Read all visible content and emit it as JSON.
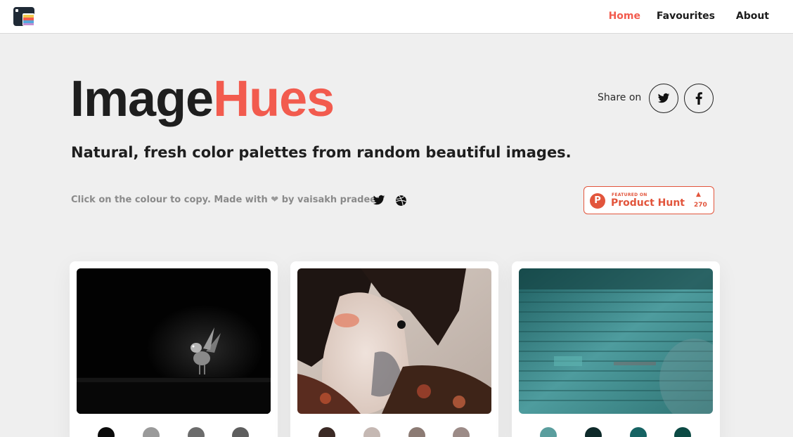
{
  "nav": {
    "items": [
      {
        "label": "Home",
        "active": true
      },
      {
        "label": "Favourites",
        "active": false
      },
      {
        "label": "About",
        "active": false
      }
    ],
    "accent": "#f25b4e"
  },
  "hero": {
    "brand_part1": "Image",
    "brand_part2": "Hues",
    "share_label": "Share on",
    "share_icons": [
      "twitter-icon",
      "facebook-icon"
    ],
    "tagline": "Natural, fresh color palettes from random beautiful images.",
    "credits_prefix": "Click on the colour to copy. Made with",
    "credits_suffix": "by vaisakh pradeep",
    "credits_icons": [
      "heart-icon",
      "twitter-icon",
      "dribbble-icon"
    ]
  },
  "product_hunt": {
    "featured": "FEATURED ON",
    "name": "Product Hunt",
    "letter": "P",
    "upvotes": "270",
    "color": "#e2553c"
  },
  "cards": [
    {
      "subject": "bird on black",
      "swatches": [
        "#0b0b0b",
        "#9a9a9a",
        "#6c6c6c",
        "#5e5e5e"
      ]
    },
    {
      "subject": "woman with tattoo",
      "swatches": [
        "#3b2a25",
        "#c5b8b3",
        "#8c7b74",
        "#9c8b87"
      ]
    },
    {
      "subject": "teal wooden wall",
      "swatches": [
        "#5a9e9e",
        "#0e2a2a",
        "#166363",
        "#0c4a44"
      ]
    }
  ]
}
